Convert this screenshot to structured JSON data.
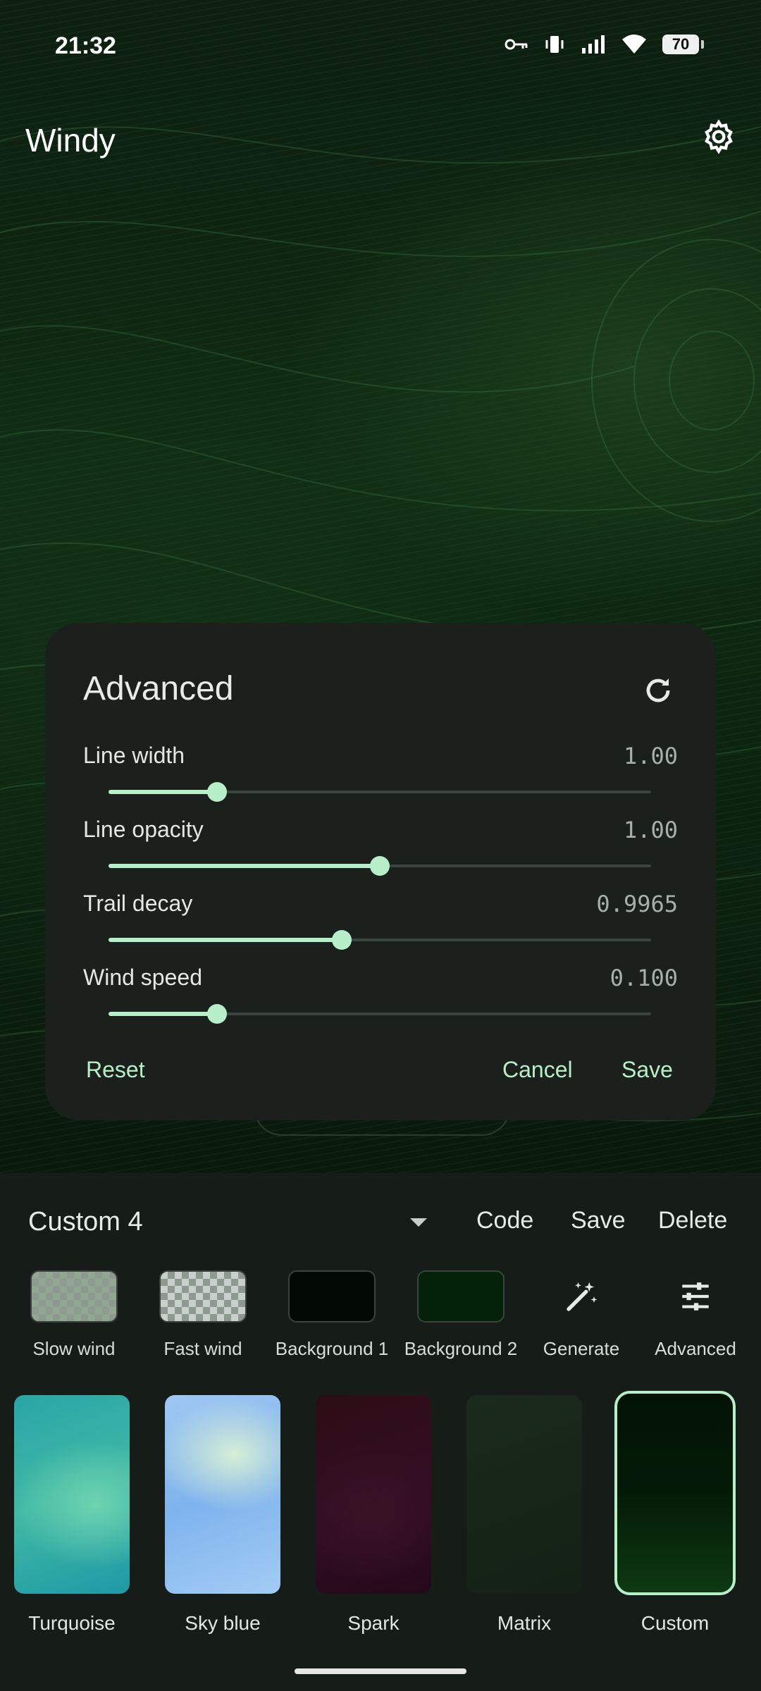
{
  "status_bar": {
    "time": "21:32",
    "battery": "70",
    "icons": [
      "key-icon",
      "vibrate-icon",
      "signal-icon",
      "wifi-icon",
      "battery-icon"
    ]
  },
  "app_bar": {
    "title": "Windy",
    "settings_icon": "gear-icon"
  },
  "dialog": {
    "title": "Advanced",
    "refresh_icon": "refresh-icon",
    "settings": [
      {
        "label": "Line width",
        "value": "1.00",
        "level": 0.2
      },
      {
        "label": "Line opacity",
        "value": "1.00",
        "level": 0.5
      },
      {
        "label": "Trail decay",
        "value": "0.9965",
        "level": 0.43
      },
      {
        "label": "Wind speed",
        "value": "0.100",
        "level": 0.2
      }
    ],
    "reset_label": "Reset",
    "cancel_label": "Cancel",
    "save_label": "Save"
  },
  "bottom_panel": {
    "preset_name": "Custom 4",
    "code_label": "Code",
    "save_label": "Save",
    "delete_label": "Delete",
    "tools": [
      {
        "label": "Slow wind"
      },
      {
        "label": "Fast wind"
      },
      {
        "label": "Background 1",
        "color": "#020a03"
      },
      {
        "label": "Background 2",
        "color": "#04210a"
      },
      {
        "label": "Generate",
        "icon": "magic-wand-icon"
      },
      {
        "label": "Advanced",
        "icon": "tune-icon"
      }
    ],
    "themes": [
      {
        "label": "Turquoise"
      },
      {
        "label": "Sky blue"
      },
      {
        "label": "Spark"
      },
      {
        "label": "Matrix"
      },
      {
        "label": "Custom",
        "selected": true
      }
    ]
  },
  "colors": {
    "accent": "#b6efc8",
    "dialog_bg": "#1b201d",
    "panel_bg": "#161c18"
  }
}
